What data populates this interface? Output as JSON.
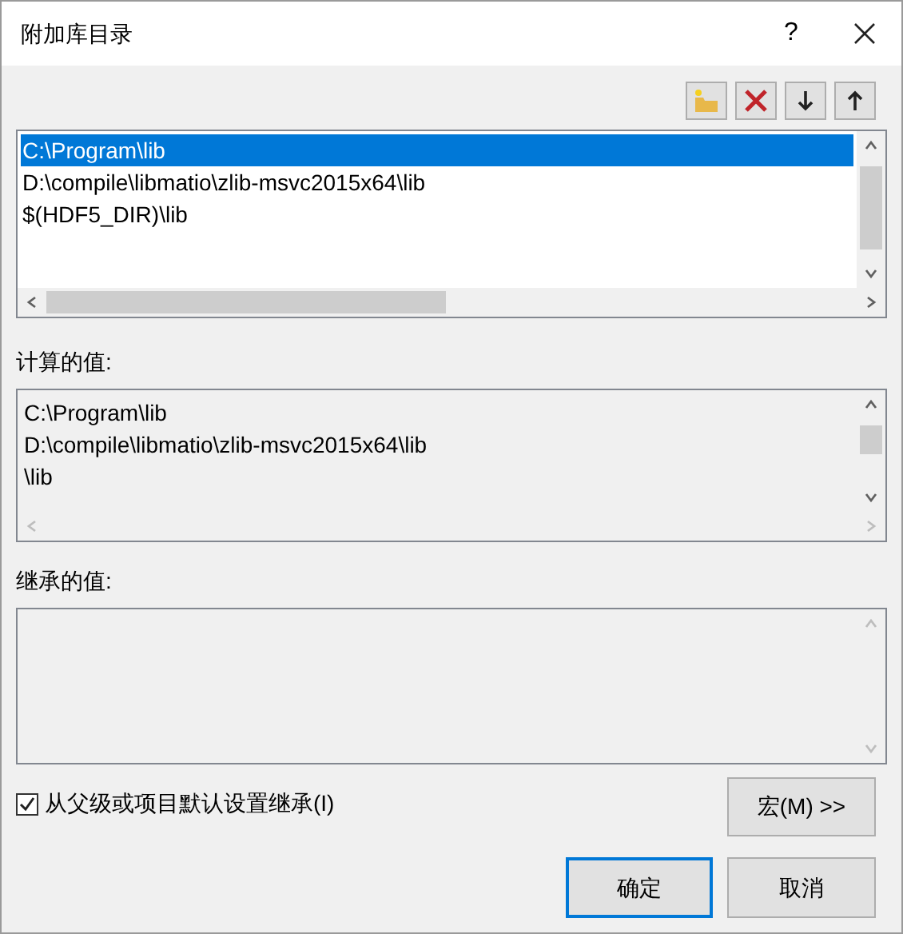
{
  "window": {
    "title": "附加库目录",
    "help": "?"
  },
  "directories": {
    "items": [
      {
        "text": "C:\\Program\\lib",
        "selected": true
      },
      {
        "text": "D:\\compile\\libmatio\\zlib-msvc2015x64\\lib",
        "selected": false
      },
      {
        "text": "$(HDF5_DIR)\\lib",
        "selected": false
      }
    ]
  },
  "computed_values": {
    "label": "计算的值:",
    "lines": [
      "C:\\Program\\lib",
      "D:\\compile\\libmatio\\zlib-msvc2015x64\\lib",
      "\\lib"
    ]
  },
  "inherited_values": {
    "label": "继承的值:"
  },
  "inherit_checkbox": {
    "label": "从父级或项目默认设置继承(I)",
    "checked": true
  },
  "buttons": {
    "macros": "宏(M) >>",
    "ok": "确定",
    "cancel": "取消"
  }
}
